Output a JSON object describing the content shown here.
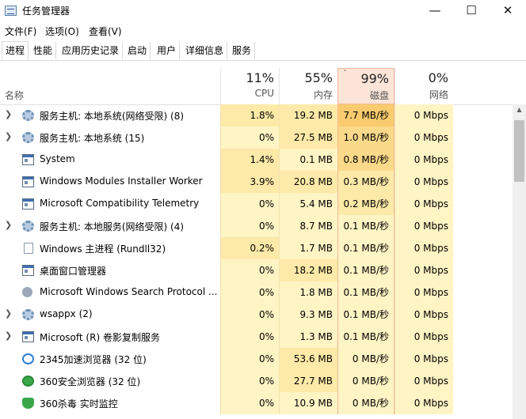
{
  "window": {
    "title": "任务管理器",
    "minimize": "—",
    "maximize": "☐",
    "close": "✕"
  },
  "menu": [
    "文件(F)",
    "选项(O)",
    "查看(V)"
  ],
  "tabs": [
    "进程",
    "性能",
    "应用历史记录",
    "启动",
    "用户",
    "详细信息",
    "服务"
  ],
  "header": {
    "name_label": "名称",
    "sort_glyph": "ˇ",
    "columns": [
      {
        "key": "cpu",
        "pct": "11%",
        "label": "CPU"
      },
      {
        "key": "mem",
        "pct": "55%",
        "label": "内存"
      },
      {
        "key": "disk",
        "pct": "99%",
        "label": "磁盘"
      },
      {
        "key": "net",
        "pct": "0%",
        "label": "网络"
      }
    ]
  },
  "colors": {
    "heat_low": "#fff4c4",
    "heat_mid": "#fde9a8",
    "heat_high": "#fbd98a",
    "heat_top": "#f9cb6e",
    "sorted_header": "#fce5d8",
    "sorted_border": "#f0b898"
  },
  "processes": [
    {
      "expandable": true,
      "icon": "gear-icon",
      "name": "服务主机: 本地系统(网络受限) (8)",
      "cpu": "1.8%",
      "mem": "19.2 MB",
      "disk": "7.7 MB/秒",
      "net": "0 Mbps",
      "disk_heat": 4,
      "cpu_heat": 2,
      "mem_heat": 2
    },
    {
      "expandable": true,
      "icon": "gear-icon",
      "name": "服务主机: 本地系统 (15)",
      "cpu": "0%",
      "mem": "27.5 MB",
      "disk": "1.0 MB/秒",
      "net": "0 Mbps",
      "disk_heat": 3,
      "cpu_heat": 1,
      "mem_heat": 2
    },
    {
      "expandable": false,
      "icon": "window-icon",
      "name": "System",
      "cpu": "1.4%",
      "mem": "0.1 MB",
      "disk": "0.8 MB/秒",
      "net": "0 Mbps",
      "disk_heat": 3,
      "cpu_heat": 2,
      "mem_heat": 1
    },
    {
      "expandable": false,
      "icon": "window-icon",
      "name": "Windows Modules Installer Worker",
      "cpu": "3.9%",
      "mem": "20.8 MB",
      "disk": "0.3 MB/秒",
      "net": "0 Mbps",
      "disk_heat": 2,
      "cpu_heat": 2,
      "mem_heat": 2
    },
    {
      "expandable": false,
      "icon": "window-icon",
      "name": "Microsoft Compatibility Telemetry",
      "cpu": "0%",
      "mem": "5.4 MB",
      "disk": "0.2 MB/秒",
      "net": "0 Mbps",
      "disk_heat": 2,
      "cpu_heat": 1,
      "mem_heat": 1
    },
    {
      "expandable": true,
      "icon": "gear-icon",
      "name": "服务主机: 本地服务(网络受限) (4)",
      "cpu": "0%",
      "mem": "8.7 MB",
      "disk": "0.1 MB/秒",
      "net": "0 Mbps",
      "disk_heat": 1,
      "cpu_heat": 1,
      "mem_heat": 1
    },
    {
      "expandable": false,
      "icon": "document-icon",
      "name": "Windows 主进程 (Rundll32)",
      "cpu": "0.2%",
      "mem": "1.7 MB",
      "disk": "0.1 MB/秒",
      "net": "0 Mbps",
      "disk_heat": 1,
      "cpu_heat": 2,
      "mem_heat": 1
    },
    {
      "expandable": false,
      "icon": "window-icon",
      "name": "桌面窗口管理器",
      "cpu": "0%",
      "mem": "18.2 MB",
      "disk": "0.1 MB/秒",
      "net": "0 Mbps",
      "disk_heat": 1,
      "cpu_heat": 1,
      "mem_heat": 2
    },
    {
      "expandable": false,
      "icon": "user-icon",
      "name": "Microsoft Windows Search Protocol ...",
      "cpu": "0%",
      "mem": "1.8 MB",
      "disk": "0.1 MB/秒",
      "net": "0 Mbps",
      "disk_heat": 1,
      "cpu_heat": 1,
      "mem_heat": 1
    },
    {
      "expandable": true,
      "icon": "gear-icon",
      "name": "wsappx (2)",
      "cpu": "0%",
      "mem": "9.3 MB",
      "disk": "0.1 MB/秒",
      "net": "0 Mbps",
      "disk_heat": 1,
      "cpu_heat": 1,
      "mem_heat": 1
    },
    {
      "expandable": true,
      "icon": "window-icon",
      "name": "Microsoft (R) 卷影复制服务",
      "cpu": "0%",
      "mem": "1.3 MB",
      "disk": "0.1 MB/秒",
      "net": "0 Mbps",
      "disk_heat": 1,
      "cpu_heat": 1,
      "mem_heat": 1
    },
    {
      "expandable": false,
      "icon": "ie-icon",
      "name": "2345加速浏览器 (32 位)",
      "cpu": "0%",
      "mem": "53.6 MB",
      "disk": "0 MB/秒",
      "net": "0 Mbps",
      "disk_heat": 1,
      "cpu_heat": 1,
      "mem_heat": 2
    },
    {
      "expandable": false,
      "icon": "green-e-icon",
      "name": "360安全浏览器 (32 位)",
      "cpu": "0%",
      "mem": "27.7 MB",
      "disk": "0 MB/秒",
      "net": "0 Mbps",
      "disk_heat": 1,
      "cpu_heat": 1,
      "mem_heat": 2
    },
    {
      "expandable": false,
      "icon": "shield-icon",
      "name": "360杀毒 实时监控",
      "cpu": "0%",
      "mem": "10.9 MB",
      "disk": "0 MB/秒",
      "net": "0 Mbps",
      "disk_heat": 1,
      "cpu_heat": 1,
      "mem_heat": 1
    }
  ]
}
